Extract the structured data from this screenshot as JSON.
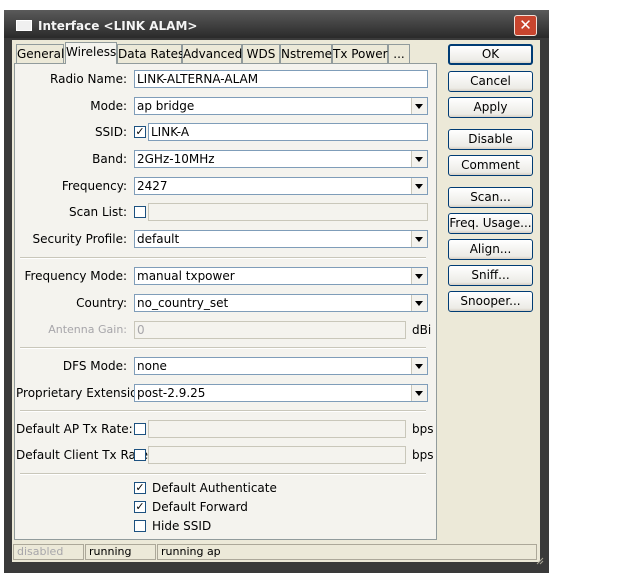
{
  "window": {
    "title": "Interface <LINK ALAM>",
    "close_glyph": "✕"
  },
  "tabs": [
    {
      "label": "General"
    },
    {
      "label": "Wireless"
    },
    {
      "label": "Data Rates"
    },
    {
      "label": "Advanced"
    },
    {
      "label": "WDS"
    },
    {
      "label": "Nstreme"
    },
    {
      "label": "Tx Power"
    },
    {
      "label": "..."
    }
  ],
  "active_tab": "Wireless",
  "form": {
    "radio_name": {
      "label": "Radio Name:",
      "value": "LINK-ALTERNA-ALAM"
    },
    "mode": {
      "label": "Mode:",
      "value": "ap bridge"
    },
    "ssid": {
      "label": "SSID:",
      "value": "LINK-A",
      "check": "✓"
    },
    "band": {
      "label": "Band:",
      "value": "2GHz-10MHz"
    },
    "frequency": {
      "label": "Frequency:",
      "value": "2427"
    },
    "scan_list": {
      "label": "Scan List:",
      "value": ""
    },
    "security_profile": {
      "label": "Security Profile:",
      "value": "default"
    },
    "frequency_mode": {
      "label": "Frequency Mode:",
      "value": "manual txpower"
    },
    "country": {
      "label": "Country:",
      "value": "no_country_set"
    },
    "antenna_gain": {
      "label": "Antenna Gain:",
      "value": "0",
      "unit": "dBi"
    },
    "dfs_mode": {
      "label": "DFS Mode:",
      "value": "none"
    },
    "proprietary_extensions": {
      "label": "Proprietary Extensions:",
      "value": "post-2.9.25"
    },
    "default_ap_tx_rate": {
      "label": "Default AP Tx Rate:",
      "value": "",
      "unit": "bps"
    },
    "default_client_tx_rate": {
      "label": "Default Client Tx Rate:",
      "value": "",
      "unit": "bps"
    },
    "default_authenticate": {
      "label": "Default Authenticate",
      "checked": true,
      "check": "✓"
    },
    "default_forward": {
      "label": "Default Forward",
      "checked": true,
      "check": "✓"
    },
    "hide_ssid": {
      "label": "Hide SSID",
      "checked": false
    }
  },
  "buttons": {
    "ok": "OK",
    "cancel": "Cancel",
    "apply": "Apply",
    "disable": "Disable",
    "comment": "Comment",
    "scan": "Scan...",
    "freq_usage": "Freq. Usage...",
    "align": "Align...",
    "sniff": "Sniff...",
    "snooper": "Snooper..."
  },
  "status": {
    "field1": "disabled",
    "field2": "running",
    "field3": "running ap"
  },
  "colors": {
    "title_bar": "#3a3a3a",
    "close_button": "#c8452e",
    "dialog_bg": "#ece9d8",
    "panel_bg": "#f4f3ee",
    "button_border": "#003c74"
  }
}
